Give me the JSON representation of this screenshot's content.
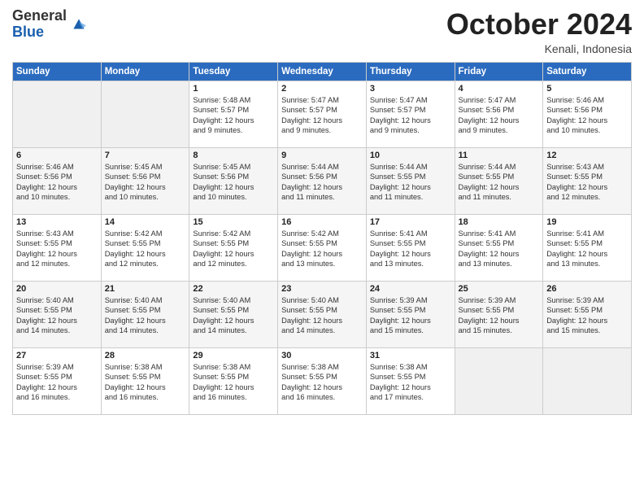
{
  "header": {
    "logo_general": "General",
    "logo_blue": "Blue",
    "month_year": "October 2024",
    "location": "Kenali, Indonesia"
  },
  "columns": [
    "Sunday",
    "Monday",
    "Tuesday",
    "Wednesday",
    "Thursday",
    "Friday",
    "Saturday"
  ],
  "weeks": [
    [
      {
        "day": "",
        "info": ""
      },
      {
        "day": "",
        "info": ""
      },
      {
        "day": "1",
        "info": "Sunrise: 5:48 AM\nSunset: 5:57 PM\nDaylight: 12 hours\nand 9 minutes."
      },
      {
        "day": "2",
        "info": "Sunrise: 5:47 AM\nSunset: 5:57 PM\nDaylight: 12 hours\nand 9 minutes."
      },
      {
        "day": "3",
        "info": "Sunrise: 5:47 AM\nSunset: 5:57 PM\nDaylight: 12 hours\nand 9 minutes."
      },
      {
        "day": "4",
        "info": "Sunrise: 5:47 AM\nSunset: 5:56 PM\nDaylight: 12 hours\nand 9 minutes."
      },
      {
        "day": "5",
        "info": "Sunrise: 5:46 AM\nSunset: 5:56 PM\nDaylight: 12 hours\nand 10 minutes."
      }
    ],
    [
      {
        "day": "6",
        "info": "Sunrise: 5:46 AM\nSunset: 5:56 PM\nDaylight: 12 hours\nand 10 minutes."
      },
      {
        "day": "7",
        "info": "Sunrise: 5:45 AM\nSunset: 5:56 PM\nDaylight: 12 hours\nand 10 minutes."
      },
      {
        "day": "8",
        "info": "Sunrise: 5:45 AM\nSunset: 5:56 PM\nDaylight: 12 hours\nand 10 minutes."
      },
      {
        "day": "9",
        "info": "Sunrise: 5:44 AM\nSunset: 5:56 PM\nDaylight: 12 hours\nand 11 minutes."
      },
      {
        "day": "10",
        "info": "Sunrise: 5:44 AM\nSunset: 5:55 PM\nDaylight: 12 hours\nand 11 minutes."
      },
      {
        "day": "11",
        "info": "Sunrise: 5:44 AM\nSunset: 5:55 PM\nDaylight: 12 hours\nand 11 minutes."
      },
      {
        "day": "12",
        "info": "Sunrise: 5:43 AM\nSunset: 5:55 PM\nDaylight: 12 hours\nand 12 minutes."
      }
    ],
    [
      {
        "day": "13",
        "info": "Sunrise: 5:43 AM\nSunset: 5:55 PM\nDaylight: 12 hours\nand 12 minutes."
      },
      {
        "day": "14",
        "info": "Sunrise: 5:42 AM\nSunset: 5:55 PM\nDaylight: 12 hours\nand 12 minutes."
      },
      {
        "day": "15",
        "info": "Sunrise: 5:42 AM\nSunset: 5:55 PM\nDaylight: 12 hours\nand 12 minutes."
      },
      {
        "day": "16",
        "info": "Sunrise: 5:42 AM\nSunset: 5:55 PM\nDaylight: 12 hours\nand 13 minutes."
      },
      {
        "day": "17",
        "info": "Sunrise: 5:41 AM\nSunset: 5:55 PM\nDaylight: 12 hours\nand 13 minutes."
      },
      {
        "day": "18",
        "info": "Sunrise: 5:41 AM\nSunset: 5:55 PM\nDaylight: 12 hours\nand 13 minutes."
      },
      {
        "day": "19",
        "info": "Sunrise: 5:41 AM\nSunset: 5:55 PM\nDaylight: 12 hours\nand 13 minutes."
      }
    ],
    [
      {
        "day": "20",
        "info": "Sunrise: 5:40 AM\nSunset: 5:55 PM\nDaylight: 12 hours\nand 14 minutes."
      },
      {
        "day": "21",
        "info": "Sunrise: 5:40 AM\nSunset: 5:55 PM\nDaylight: 12 hours\nand 14 minutes."
      },
      {
        "day": "22",
        "info": "Sunrise: 5:40 AM\nSunset: 5:55 PM\nDaylight: 12 hours\nand 14 minutes."
      },
      {
        "day": "23",
        "info": "Sunrise: 5:40 AM\nSunset: 5:55 PM\nDaylight: 12 hours\nand 14 minutes."
      },
      {
        "day": "24",
        "info": "Sunrise: 5:39 AM\nSunset: 5:55 PM\nDaylight: 12 hours\nand 15 minutes."
      },
      {
        "day": "25",
        "info": "Sunrise: 5:39 AM\nSunset: 5:55 PM\nDaylight: 12 hours\nand 15 minutes."
      },
      {
        "day": "26",
        "info": "Sunrise: 5:39 AM\nSunset: 5:55 PM\nDaylight: 12 hours\nand 15 minutes."
      }
    ],
    [
      {
        "day": "27",
        "info": "Sunrise: 5:39 AM\nSunset: 5:55 PM\nDaylight: 12 hours\nand 16 minutes."
      },
      {
        "day": "28",
        "info": "Sunrise: 5:38 AM\nSunset: 5:55 PM\nDaylight: 12 hours\nand 16 minutes."
      },
      {
        "day": "29",
        "info": "Sunrise: 5:38 AM\nSunset: 5:55 PM\nDaylight: 12 hours\nand 16 minutes."
      },
      {
        "day": "30",
        "info": "Sunrise: 5:38 AM\nSunset: 5:55 PM\nDaylight: 12 hours\nand 16 minutes."
      },
      {
        "day": "31",
        "info": "Sunrise: 5:38 AM\nSunset: 5:55 PM\nDaylight: 12 hours\nand 17 minutes."
      },
      {
        "day": "",
        "info": ""
      },
      {
        "day": "",
        "info": ""
      }
    ]
  ]
}
